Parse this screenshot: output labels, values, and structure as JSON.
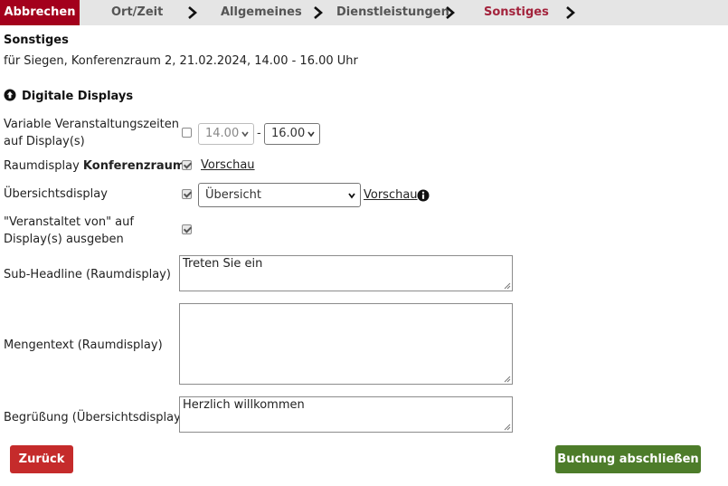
{
  "stepper": {
    "abort_label": "Abbrechen",
    "steps": [
      "Ort/Zeit",
      "Allgemeines",
      "Dienstleistungen",
      "Sonstiges"
    ],
    "active_step": "Sonstiges",
    "accent_color": "#a3001c"
  },
  "page": {
    "heading": "Sonstiges",
    "subtitle": "für Siegen, Konferenzraum 2, 21.02.2024, 14.00 - 16.00 Uhr"
  },
  "section": {
    "title": "Digitale Displays",
    "icon": "arrow-up-circle-icon"
  },
  "form": {
    "variable_times": {
      "label_line1": "Variable Veranstaltungszeiten",
      "label_line2": "auf Display(s)",
      "checked": false,
      "start": "14.00",
      "separator": "-",
      "end": "16.00"
    },
    "room_display": {
      "label_prefix": "Raumdisplay",
      "label_room": "Konferenzraum",
      "checked": true,
      "preview_link": "Vorschau"
    },
    "overview_display": {
      "label": "Übersichtsdisplay",
      "checked": true,
      "selected": "Übersicht",
      "preview_link": "Vorschau",
      "info_icon": "info-icon"
    },
    "organizer": {
      "label_line1": "\"Veranstaltet von\" auf",
      "label_line2": "Display(s) ausgeben",
      "checked": true
    },
    "sub_headline": {
      "label": "Sub-Headline (Raumdisplay)",
      "value": "Treten Sie ein"
    },
    "body_text": {
      "label": "Mengentext (Raumdisplay)",
      "value": ""
    },
    "greeting": {
      "label": "Begrüßung (Übersichtsdisplay)",
      "value": "Herzlich willkommen"
    }
  },
  "actions": {
    "back_label": "Zurück",
    "finish_label": "Buchung abschließen",
    "back_color": "#c52b2b",
    "finish_color": "#4d7c2a"
  }
}
